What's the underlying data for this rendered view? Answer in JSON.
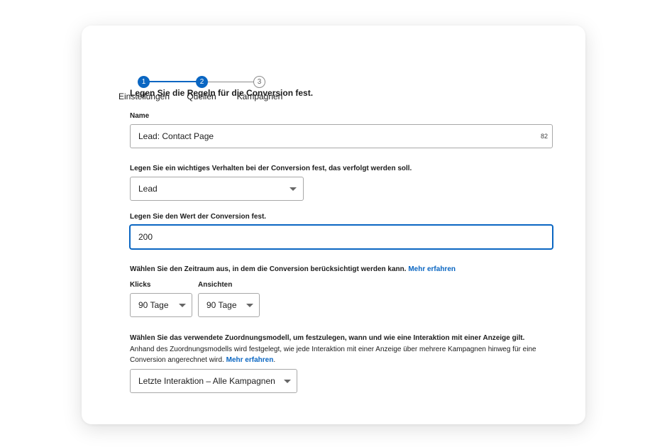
{
  "stepper": {
    "steps": [
      {
        "number": "1",
        "label": "Einstellungen"
      },
      {
        "number": "2",
        "label": "Quellen"
      },
      {
        "number": "3",
        "label": "Kampagnen"
      }
    ]
  },
  "form": {
    "heading": "Legen Sie die Regeln für die Conversion fest.",
    "name": {
      "label": "Name",
      "value": "Lead: Contact Page",
      "counter": "82"
    },
    "behavior": {
      "label": "Legen Sie ein wichtiges Verhalten bei der Conversion fest, das verfolgt werden soll.",
      "value": "Lead"
    },
    "conversion_value": {
      "label": "Legen Sie den Wert der Conversion fest.",
      "value": "200"
    },
    "window": {
      "label": "Wählen Sie den Zeitraum aus, in dem die Conversion berücksichtigt werden kann.",
      "link": "Mehr erfahren",
      "clicks_label": "Klicks",
      "clicks_value": "90 Tage",
      "views_label": "Ansichten",
      "views_value": "90 Tage"
    },
    "attribution": {
      "label": "Wählen Sie das verwendete Zuordnungsmodell, um festzulegen, wann und wie eine Interaktion mit einer Anzeige gilt.",
      "desc_line1": "Anhand des Zuordnungsmodells wird festgelegt, wie jede Interaktion mit einer Anzeige über mehrere Kampagnen hinweg für eine",
      "desc_line2": "Conversion angerechnet wird.",
      "link": "Mehr erfahren",
      "link_suffix": ".",
      "value": "Letzte Interaktion – Alle Kampagnen"
    }
  },
  "colors": {
    "accent": "#0a66c2",
    "border": "#a8a8a8",
    "text": "#1d1d1d"
  }
}
